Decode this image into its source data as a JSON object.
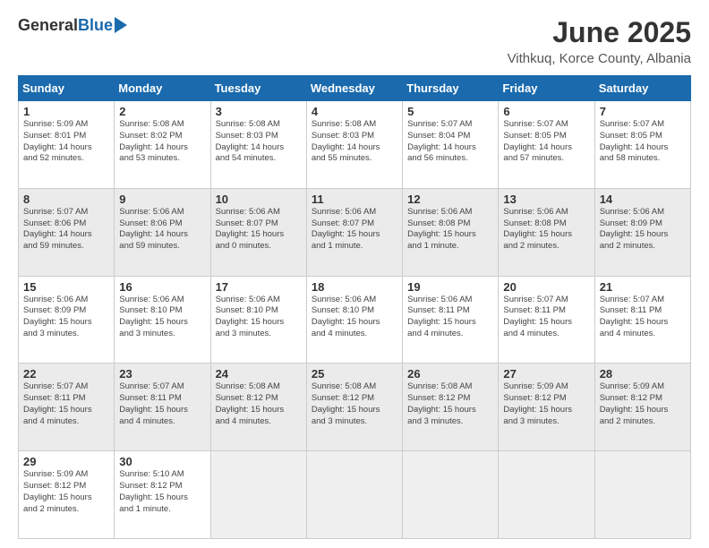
{
  "header": {
    "logo_general": "General",
    "logo_blue": "Blue",
    "month_title": "June 2025",
    "location": "Vithkuq, Korce County, Albania"
  },
  "weekdays": [
    "Sunday",
    "Monday",
    "Tuesday",
    "Wednesday",
    "Thursday",
    "Friday",
    "Saturday"
  ],
  "weeks": [
    [
      {
        "day": "1",
        "info": "Sunrise: 5:09 AM\nSunset: 8:01 PM\nDaylight: 14 hours\nand 52 minutes.",
        "shaded": false
      },
      {
        "day": "2",
        "info": "Sunrise: 5:08 AM\nSunset: 8:02 PM\nDaylight: 14 hours\nand 53 minutes.",
        "shaded": false
      },
      {
        "day": "3",
        "info": "Sunrise: 5:08 AM\nSunset: 8:03 PM\nDaylight: 14 hours\nand 54 minutes.",
        "shaded": false
      },
      {
        "day": "4",
        "info": "Sunrise: 5:08 AM\nSunset: 8:03 PM\nDaylight: 14 hours\nand 55 minutes.",
        "shaded": false
      },
      {
        "day": "5",
        "info": "Sunrise: 5:07 AM\nSunset: 8:04 PM\nDaylight: 14 hours\nand 56 minutes.",
        "shaded": false
      },
      {
        "day": "6",
        "info": "Sunrise: 5:07 AM\nSunset: 8:05 PM\nDaylight: 14 hours\nand 57 minutes.",
        "shaded": false
      },
      {
        "day": "7",
        "info": "Sunrise: 5:07 AM\nSunset: 8:05 PM\nDaylight: 14 hours\nand 58 minutes.",
        "shaded": false
      }
    ],
    [
      {
        "day": "8",
        "info": "Sunrise: 5:07 AM\nSunset: 8:06 PM\nDaylight: 14 hours\nand 59 minutes.",
        "shaded": true
      },
      {
        "day": "9",
        "info": "Sunrise: 5:06 AM\nSunset: 8:06 PM\nDaylight: 14 hours\nand 59 minutes.",
        "shaded": true
      },
      {
        "day": "10",
        "info": "Sunrise: 5:06 AM\nSunset: 8:07 PM\nDaylight: 15 hours\nand 0 minutes.",
        "shaded": true
      },
      {
        "day": "11",
        "info": "Sunrise: 5:06 AM\nSunset: 8:07 PM\nDaylight: 15 hours\nand 1 minute.",
        "shaded": true
      },
      {
        "day": "12",
        "info": "Sunrise: 5:06 AM\nSunset: 8:08 PM\nDaylight: 15 hours\nand 1 minute.",
        "shaded": true
      },
      {
        "day": "13",
        "info": "Sunrise: 5:06 AM\nSunset: 8:08 PM\nDaylight: 15 hours\nand 2 minutes.",
        "shaded": true
      },
      {
        "day": "14",
        "info": "Sunrise: 5:06 AM\nSunset: 8:09 PM\nDaylight: 15 hours\nand 2 minutes.",
        "shaded": true
      }
    ],
    [
      {
        "day": "15",
        "info": "Sunrise: 5:06 AM\nSunset: 8:09 PM\nDaylight: 15 hours\nand 3 minutes.",
        "shaded": false
      },
      {
        "day": "16",
        "info": "Sunrise: 5:06 AM\nSunset: 8:10 PM\nDaylight: 15 hours\nand 3 minutes.",
        "shaded": false
      },
      {
        "day": "17",
        "info": "Sunrise: 5:06 AM\nSunset: 8:10 PM\nDaylight: 15 hours\nand 3 minutes.",
        "shaded": false
      },
      {
        "day": "18",
        "info": "Sunrise: 5:06 AM\nSunset: 8:10 PM\nDaylight: 15 hours\nand 4 minutes.",
        "shaded": false
      },
      {
        "day": "19",
        "info": "Sunrise: 5:06 AM\nSunset: 8:11 PM\nDaylight: 15 hours\nand 4 minutes.",
        "shaded": false
      },
      {
        "day": "20",
        "info": "Sunrise: 5:07 AM\nSunset: 8:11 PM\nDaylight: 15 hours\nand 4 minutes.",
        "shaded": false
      },
      {
        "day": "21",
        "info": "Sunrise: 5:07 AM\nSunset: 8:11 PM\nDaylight: 15 hours\nand 4 minutes.",
        "shaded": false
      }
    ],
    [
      {
        "day": "22",
        "info": "Sunrise: 5:07 AM\nSunset: 8:11 PM\nDaylight: 15 hours\nand 4 minutes.",
        "shaded": true
      },
      {
        "day": "23",
        "info": "Sunrise: 5:07 AM\nSunset: 8:11 PM\nDaylight: 15 hours\nand 4 minutes.",
        "shaded": true
      },
      {
        "day": "24",
        "info": "Sunrise: 5:08 AM\nSunset: 8:12 PM\nDaylight: 15 hours\nand 4 minutes.",
        "shaded": true
      },
      {
        "day": "25",
        "info": "Sunrise: 5:08 AM\nSunset: 8:12 PM\nDaylight: 15 hours\nand 3 minutes.",
        "shaded": true
      },
      {
        "day": "26",
        "info": "Sunrise: 5:08 AM\nSunset: 8:12 PM\nDaylight: 15 hours\nand 3 minutes.",
        "shaded": true
      },
      {
        "day": "27",
        "info": "Sunrise: 5:09 AM\nSunset: 8:12 PM\nDaylight: 15 hours\nand 3 minutes.",
        "shaded": true
      },
      {
        "day": "28",
        "info": "Sunrise: 5:09 AM\nSunset: 8:12 PM\nDaylight: 15 hours\nand 2 minutes.",
        "shaded": true
      }
    ],
    [
      {
        "day": "29",
        "info": "Sunrise: 5:09 AM\nSunset: 8:12 PM\nDaylight: 15 hours\nand 2 minutes.",
        "shaded": false
      },
      {
        "day": "30",
        "info": "Sunrise: 5:10 AM\nSunset: 8:12 PM\nDaylight: 15 hours\nand 1 minute.",
        "shaded": false
      },
      {
        "day": "",
        "info": "",
        "shaded": false,
        "empty": true
      },
      {
        "day": "",
        "info": "",
        "shaded": false,
        "empty": true
      },
      {
        "day": "",
        "info": "",
        "shaded": false,
        "empty": true
      },
      {
        "day": "",
        "info": "",
        "shaded": false,
        "empty": true
      },
      {
        "day": "",
        "info": "",
        "shaded": false,
        "empty": true
      }
    ]
  ]
}
